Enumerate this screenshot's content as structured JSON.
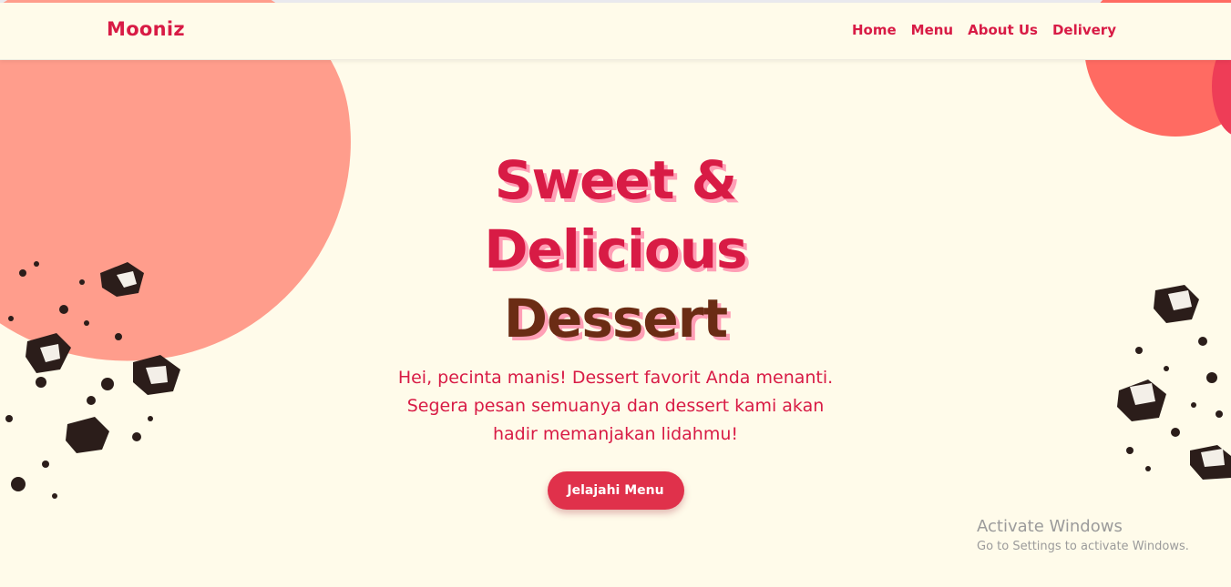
{
  "navbar": {
    "brand": "Mooniz",
    "links": [
      "Home",
      "Menu",
      "About Us",
      "Delivery"
    ]
  },
  "hero": {
    "title_lines": [
      "Sweet &",
      "Delicious",
      "Dessert"
    ],
    "description": "Hei, pecinta manis! Dessert favorit Anda menanti. Segera pesan semuanya dan dessert kami akan hadir memanjakan lidahmu!",
    "cta_label": "Jelajahi Menu"
  },
  "watermark": {
    "title": "Activate Windows",
    "subtitle": "Go to Settings to activate Windows."
  },
  "colors": {
    "background": "#fffbea",
    "brand_red": "#d81b45",
    "brown": "#6b2c14",
    "title_shadow": "#ff9fb6",
    "button": "#e0314b",
    "blob_left": "#ff9d8c",
    "blob_right": "#ff6b62"
  }
}
